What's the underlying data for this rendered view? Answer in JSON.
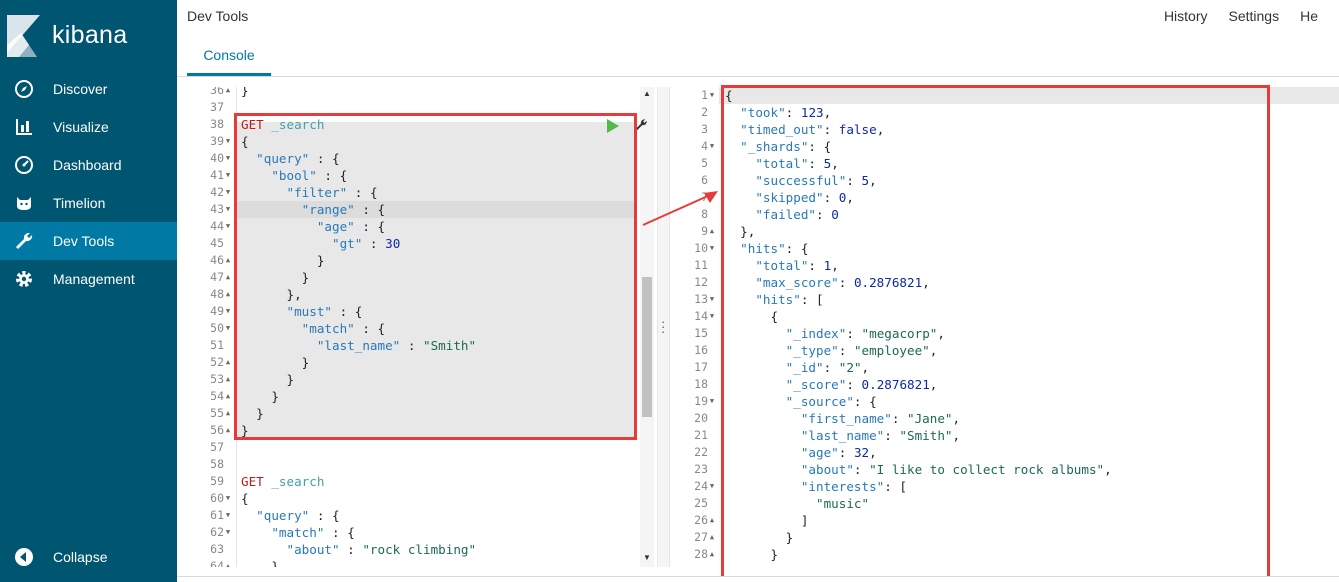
{
  "sidebar": {
    "logo_text": "kibana",
    "items": [
      {
        "label": "Discover",
        "icon": "compass-icon",
        "active": false
      },
      {
        "label": "Visualize",
        "icon": "bar-chart-icon",
        "active": false
      },
      {
        "label": "Dashboard",
        "icon": "dashboard-gauge-icon",
        "active": false
      },
      {
        "label": "Timelion",
        "icon": "timelion-cat-icon",
        "active": false
      },
      {
        "label": "Dev Tools",
        "icon": "wrench-icon",
        "active": true
      },
      {
        "label": "Management",
        "icon": "gear-icon",
        "active": false
      }
    ],
    "collapse_label": "Collapse"
  },
  "header": {
    "title": "Dev Tools",
    "tab": "Console",
    "links": [
      "History",
      "Settings",
      "He"
    ]
  },
  "colors": {
    "sidebar_bg": "#005571",
    "sidebar_active": "#0079a5",
    "accent": "#0079a5",
    "highlight_box": "#e53b3b",
    "play": "#54b948"
  },
  "request_editor": {
    "lines": [
      {
        "n": "36",
        "fold": "up",
        "text": "}"
      },
      {
        "n": "37",
        "fold": "",
        "text": ""
      },
      {
        "n": "38",
        "fold": "",
        "text": "GET _search"
      },
      {
        "n": "39",
        "fold": "down",
        "text": "{"
      },
      {
        "n": "40",
        "fold": "down",
        "text": "  \"query\" : {"
      },
      {
        "n": "41",
        "fold": "down",
        "text": "    \"bool\" : {"
      },
      {
        "n": "42",
        "fold": "down",
        "text": "      \"filter\" : {"
      },
      {
        "n": "43",
        "fold": "down",
        "text": "        \"range\" : {"
      },
      {
        "n": "44",
        "fold": "down",
        "text": "          \"age\" : {"
      },
      {
        "n": "45",
        "fold": "",
        "text": "            \"gt\" : 30"
      },
      {
        "n": "46",
        "fold": "up",
        "text": "          }"
      },
      {
        "n": "47",
        "fold": "up",
        "text": "        }"
      },
      {
        "n": "48",
        "fold": "up",
        "text": "      },"
      },
      {
        "n": "49",
        "fold": "down",
        "text": "      \"must\" : {"
      },
      {
        "n": "50",
        "fold": "down",
        "text": "        \"match\" : {"
      },
      {
        "n": "51",
        "fold": "",
        "text": "          \"last_name\" : \"Smith\""
      },
      {
        "n": "52",
        "fold": "up",
        "text": "        }"
      },
      {
        "n": "53",
        "fold": "up",
        "text": "      }"
      },
      {
        "n": "54",
        "fold": "up",
        "text": "    }"
      },
      {
        "n": "55",
        "fold": "up",
        "text": "  }"
      },
      {
        "n": "56",
        "fold": "up",
        "text": "}"
      },
      {
        "n": "57",
        "fold": "",
        "text": ""
      },
      {
        "n": "58",
        "fold": "",
        "text": ""
      },
      {
        "n": "59",
        "fold": "",
        "text": "GET _search"
      },
      {
        "n": "60",
        "fold": "down",
        "text": "{"
      },
      {
        "n": "61",
        "fold": "down",
        "text": "  \"query\" : {"
      },
      {
        "n": "62",
        "fold": "down",
        "text": "    \"match\" : {"
      },
      {
        "n": "63",
        "fold": "",
        "text": "      \"about\" : \"rock climbing\""
      },
      {
        "n": "64",
        "fold": "up",
        "text": "    }"
      }
    ]
  },
  "response_editor": {
    "lines": [
      {
        "n": "1",
        "fold": "down",
        "text": "{"
      },
      {
        "n": "2",
        "fold": "",
        "text": "  \"took\": 123,"
      },
      {
        "n": "3",
        "fold": "",
        "text": "  \"timed_out\": false,"
      },
      {
        "n": "4",
        "fold": "down",
        "text": "  \"_shards\": {"
      },
      {
        "n": "5",
        "fold": "",
        "text": "    \"total\": 5,"
      },
      {
        "n": "6",
        "fold": "",
        "text": "    \"successful\": 5,"
      },
      {
        "n": "7",
        "fold": "",
        "text": "    \"skipped\": 0,"
      },
      {
        "n": "8",
        "fold": "",
        "text": "    \"failed\": 0"
      },
      {
        "n": "9",
        "fold": "up",
        "text": "  },"
      },
      {
        "n": "10",
        "fold": "down",
        "text": "  \"hits\": {"
      },
      {
        "n": "11",
        "fold": "",
        "text": "    \"total\": 1,"
      },
      {
        "n": "12",
        "fold": "",
        "text": "    \"max_score\": 0.2876821,"
      },
      {
        "n": "13",
        "fold": "down",
        "text": "    \"hits\": ["
      },
      {
        "n": "14",
        "fold": "down",
        "text": "      {"
      },
      {
        "n": "15",
        "fold": "",
        "text": "        \"_index\": \"megacorp\","
      },
      {
        "n": "16",
        "fold": "",
        "text": "        \"_type\": \"employee\","
      },
      {
        "n": "17",
        "fold": "",
        "text": "        \"_id\": \"2\","
      },
      {
        "n": "18",
        "fold": "",
        "text": "        \"_score\": 0.2876821,"
      },
      {
        "n": "19",
        "fold": "down",
        "text": "        \"_source\": {"
      },
      {
        "n": "20",
        "fold": "",
        "text": "          \"first_name\": \"Jane\","
      },
      {
        "n": "21",
        "fold": "",
        "text": "          \"last_name\": \"Smith\","
      },
      {
        "n": "22",
        "fold": "",
        "text": "          \"age\": 32,"
      },
      {
        "n": "23",
        "fold": "",
        "text": "          \"about\": \"I like to collect rock albums\","
      },
      {
        "n": "24",
        "fold": "down",
        "text": "          \"interests\": ["
      },
      {
        "n": "25",
        "fold": "",
        "text": "            \"music\""
      },
      {
        "n": "26",
        "fold": "up",
        "text": "          ]"
      },
      {
        "n": "27",
        "fold": "up",
        "text": "        }"
      },
      {
        "n": "28",
        "fold": "up",
        "text": "      }"
      }
    ]
  }
}
